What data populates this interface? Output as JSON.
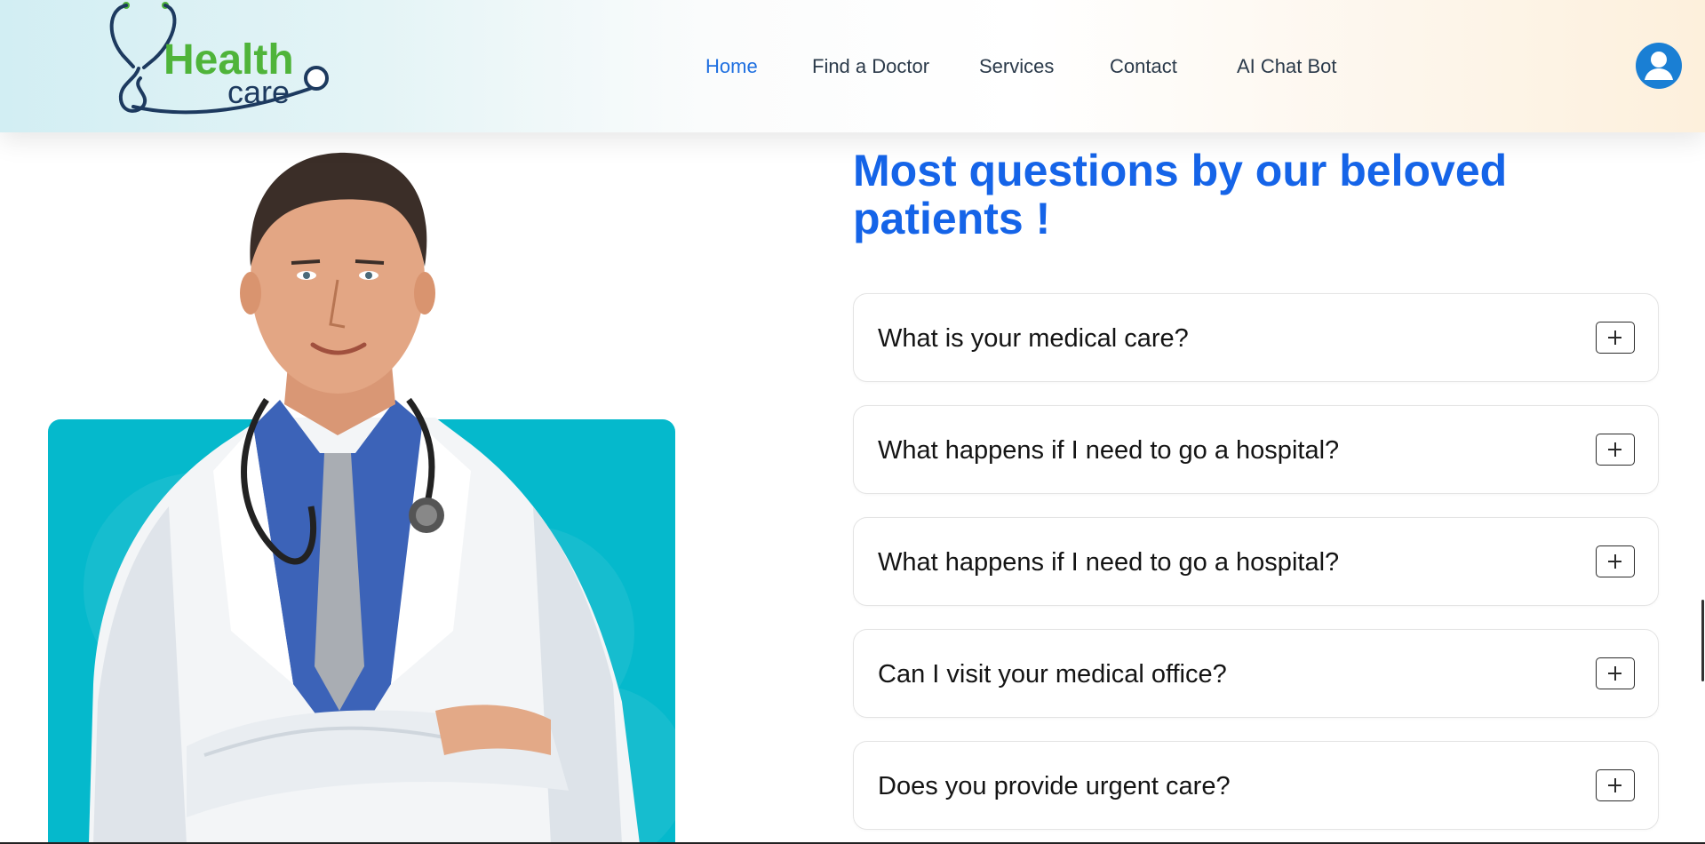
{
  "header": {
    "logo": {
      "word1": "Health",
      "word2": "care"
    },
    "nav": [
      {
        "label": "Home",
        "active": true
      },
      {
        "label": "Find a Doctor",
        "active": false
      },
      {
        "label": "Services",
        "active": false
      },
      {
        "label": "Contact",
        "active": false
      },
      {
        "label": "AI Chat Bot",
        "active": false
      }
    ],
    "user_icon": "user-avatar-icon"
  },
  "faq": {
    "title": "Most questions by our beloved patients !",
    "items": [
      {
        "question": "What is your medical care?",
        "icon": "plus-icon"
      },
      {
        "question": "What happens if I need to go a hospital?",
        "icon": "plus-icon"
      },
      {
        "question": "What happens if I need to go a hospital?",
        "icon": "plus-icon"
      },
      {
        "question": "Can I visit your medical office?",
        "icon": "plus-icon"
      },
      {
        "question": "Does you provide urgent care?",
        "icon": "plus-icon"
      }
    ]
  },
  "colors": {
    "accent": "#1564e8",
    "nav_active": "#1e6fe0",
    "photo_bg": "#05b9cc",
    "logo_green": "#4fb43a",
    "logo_navy": "#1d3a5f",
    "avatar": "#1a7fd4"
  }
}
